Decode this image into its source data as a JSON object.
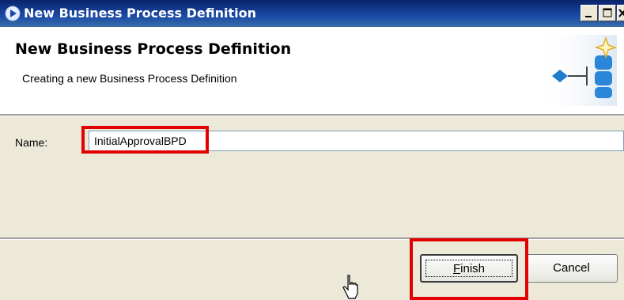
{
  "window": {
    "title": "New Business Process Definition",
    "controls": [
      "minimize",
      "maximize",
      "close"
    ]
  },
  "header": {
    "title": "New Business Process Definition",
    "description": "Creating a new Business Process Definition",
    "icon": "bpd-wizard-icon"
  },
  "form": {
    "name_label": "Name:",
    "name_value": "InitialApprovalBPD"
  },
  "buttons": {
    "finish_mnemonic": "F",
    "finish_rest": "inish",
    "cancel_label": "Cancel"
  },
  "annotations": {
    "highlight_color": "#e20000"
  }
}
